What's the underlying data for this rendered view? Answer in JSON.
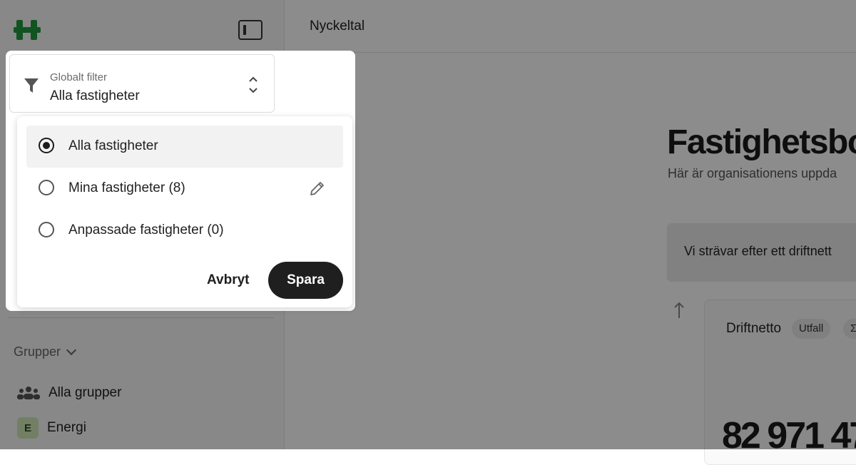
{
  "topbar": {
    "title": "Nyckeltal"
  },
  "main": {
    "title": "Fastighetsbo",
    "subtitle": "Här är organisationens uppda",
    "info_text": "Vi strävar efter ett driftnett",
    "card": {
      "title": "Driftnetto",
      "badge_outcome": "Utfall",
      "badge_sigma": "Σ",
      "value": "82 971 47"
    }
  },
  "sidebar": {
    "groups_label": "Grupper",
    "groups": [
      {
        "label": "Alla grupper",
        "icon": "people-icon"
      },
      {
        "label": "Energi",
        "badge": "E"
      }
    ]
  },
  "filter": {
    "caption": "Globalt filter",
    "value": "Alla fastigheter",
    "options": [
      {
        "label": "Alla fastigheter",
        "selected": true
      },
      {
        "label": "Mina fastigheter (8)",
        "selected": false,
        "editable": true
      },
      {
        "label": "Anpassade fastigheter (0)",
        "selected": false
      }
    ],
    "cancel_label": "Avbryt",
    "save_label": "Spara"
  },
  "colors": {
    "logo_green": "#1f9a3c",
    "primary_button": "#1f1f1f",
    "energy_badge": "#cfe8b9"
  }
}
